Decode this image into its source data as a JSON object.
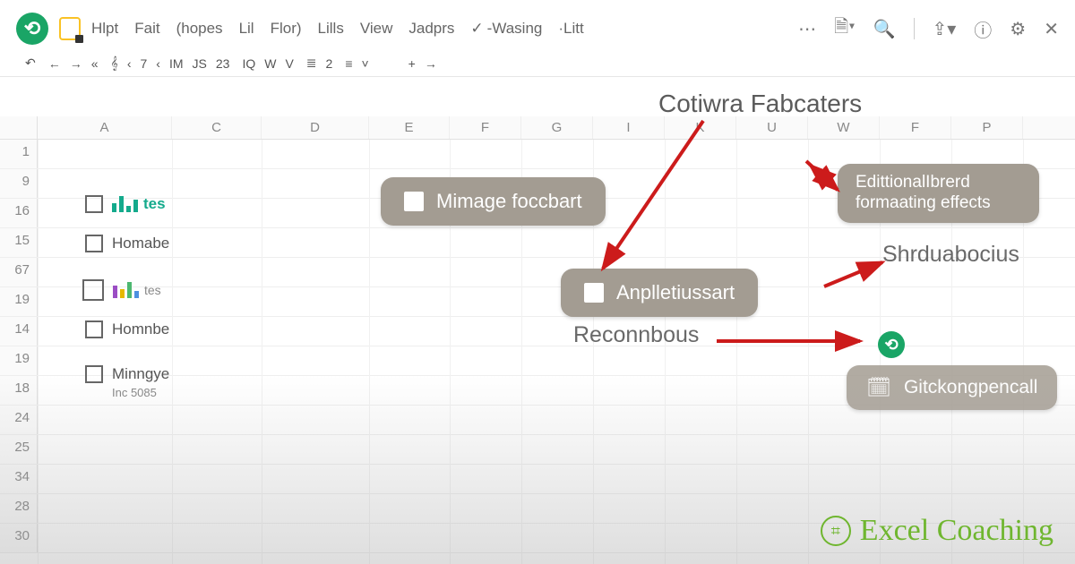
{
  "menu": {
    "items": [
      "Hlpt",
      "Fait",
      "(hopes",
      "Lil",
      "Flor)",
      "Lills",
      "View",
      "Jadprs",
      "-Wasing",
      "·Litt"
    ]
  },
  "toolbar": {
    "buttons": [
      "↶",
      "←",
      "→",
      "«",
      "𝄞",
      "‹",
      "7",
      "‹",
      "IM",
      "JS",
      "23",
      "IQ",
      "W",
      "V",
      "≣",
      "2",
      "≡",
      "˅",
      "+",
      "→"
    ]
  },
  "float_header": "Cotiwra Fabcaters",
  "columns": [
    "A",
    "C",
    "D",
    "E",
    "F",
    "G",
    "I",
    "K",
    "U",
    "W",
    "F",
    "P"
  ],
  "rows": [
    "1",
    "9",
    "16",
    "15",
    "67",
    "19",
    "14",
    "19",
    "18",
    "24",
    "25",
    "34",
    "28",
    "30"
  ],
  "checklist": {
    "item1": {
      "label": "tes",
      "colors": [
        "#14aa8c",
        "#14aa8c",
        "#14aa8c",
        "#14aa8c"
      ],
      "s": true
    },
    "item2": {
      "label": "Homabe"
    },
    "item3": {
      "label": "tes",
      "colors": [
        "#9b4dc4",
        "#e6b800",
        "#4db870",
        "#4d90e0"
      ],
      "s": true
    },
    "item4": {
      "label": "Homnbe"
    },
    "item5": {
      "label": "Minngye",
      "sub": "Inc 5085"
    }
  },
  "pills": {
    "p1": "Mimage foccbart",
    "p2": "Anplletiussart",
    "p3": "EdittionalIbrerd formaating effects",
    "p4": "Gitckongpencall"
  },
  "annotations": {
    "a1": "Reconnbous",
    "a2": "Shrduabocius"
  },
  "watermark": "Excel Coaching"
}
